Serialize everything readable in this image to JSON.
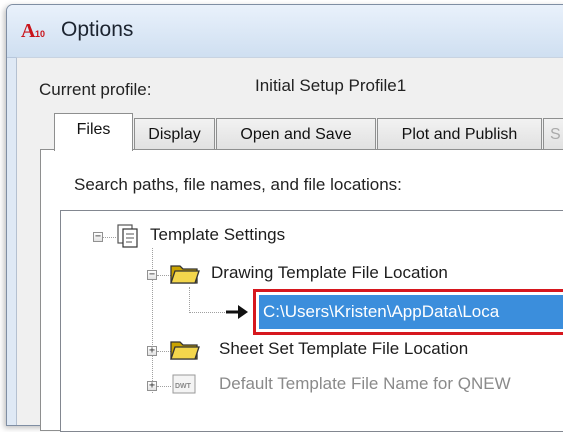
{
  "window": {
    "title": "Options",
    "icon_text": "A",
    "icon_subtext": "10"
  },
  "profile": {
    "label": "Current profile:",
    "value": "Initial Setup Profile1"
  },
  "tabs": [
    {
      "label": "Files",
      "active": true
    },
    {
      "label": "Display",
      "active": false
    },
    {
      "label": "Open and Save",
      "active": false
    },
    {
      "label": "Plot and Publish",
      "active": false
    },
    {
      "label": "S",
      "active": false
    }
  ],
  "files_panel": {
    "heading": "Search paths, file names, and file locations:",
    "tree": {
      "root": {
        "label": "Template Settings",
        "expander": "−",
        "icon": "template-settings-icon"
      },
      "drawing_template": {
        "label": "Drawing Template File Location",
        "expander": "−",
        "icon": "folder-icon"
      },
      "drawing_template_path": {
        "label": "C:\\Users\\Kristen\\AppData\\Loca",
        "icon": "arrow-icon",
        "selected": true
      },
      "sheet_set_template": {
        "label": "Sheet Set Template File Location",
        "expander": "+",
        "icon": "folder-icon"
      },
      "default_template": {
        "label": "Default Template File Name for QNEW",
        "expander": "+",
        "icon": "dwt-file-icon",
        "icon_text": "DWT"
      }
    }
  },
  "colors": {
    "selection": "#3b8edc",
    "highlight_border": "#d6171e",
    "title_bar": "#dfe9f5"
  }
}
